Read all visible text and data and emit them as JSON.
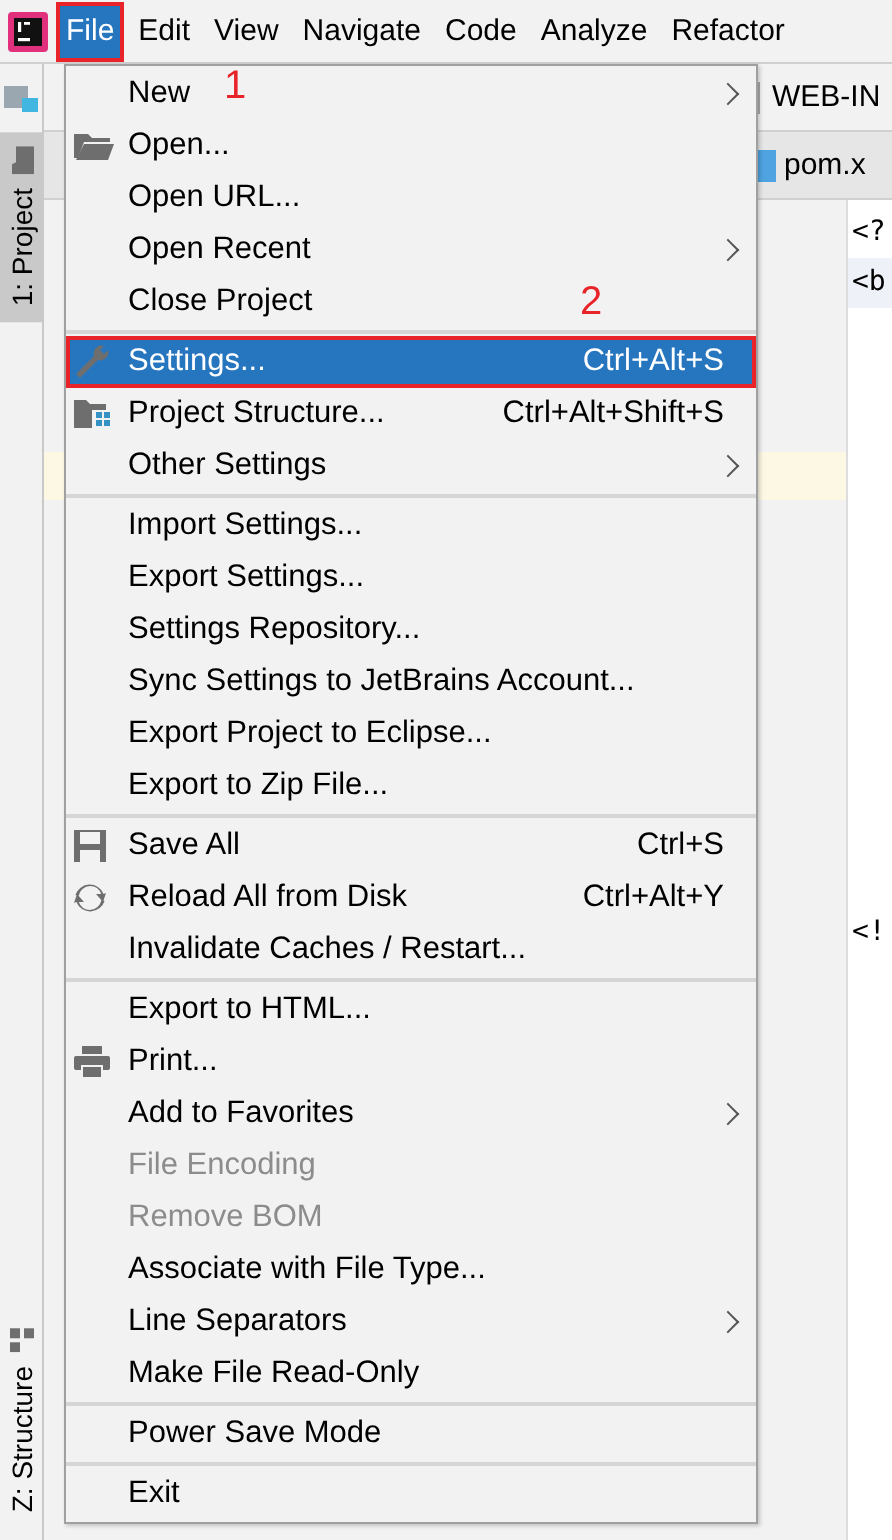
{
  "menubar": [
    {
      "label": "File",
      "selected": true,
      "marked": true
    },
    {
      "label": "Edit",
      "selected": false,
      "marked": false
    },
    {
      "label": "View",
      "selected": false,
      "marked": false
    },
    {
      "label": "Navigate",
      "selected": false,
      "marked": false
    },
    {
      "label": "Code",
      "selected": false,
      "marked": false
    },
    {
      "label": "Analyze",
      "selected": false,
      "marked": false
    },
    {
      "label": "Refactor",
      "selected": false,
      "marked": false
    }
  ],
  "sidebar": {
    "tabs": [
      {
        "label": "1: Project",
        "selected": true
      },
      {
        "label": "Z: Structure",
        "selected": false
      }
    ]
  },
  "editor": {
    "breadcrumb": "WEB-IN",
    "tab": "pom.x",
    "code_lines": [
      "<?",
      "<b",
      "<!"
    ]
  },
  "file_menu": {
    "groups": [
      [
        {
          "label": "New",
          "submenu": true,
          "disabled": false,
          "selected": false,
          "marked": false
        },
        {
          "label": "Open...",
          "submenu": false,
          "disabled": false,
          "selected": false,
          "marked": false
        },
        {
          "label": "Open URL...",
          "submenu": false,
          "disabled": false,
          "selected": false,
          "marked": false
        },
        {
          "label": "Open Recent",
          "submenu": true,
          "disabled": false,
          "selected": false,
          "marked": false
        },
        {
          "label": "Close Project",
          "submenu": false,
          "disabled": false,
          "selected": false,
          "marked": false
        }
      ],
      [
        {
          "label": "Settings...",
          "shortcut": "Ctrl+Alt+S",
          "submenu": false,
          "disabled": false,
          "selected": true,
          "marked": true
        },
        {
          "label": "Project Structure...",
          "shortcut": "Ctrl+Alt+Shift+S",
          "submenu": false,
          "disabled": false,
          "selected": false,
          "marked": false
        },
        {
          "label": "Other Settings",
          "submenu": true,
          "disabled": false,
          "selected": false,
          "marked": false
        }
      ],
      [
        {
          "label": "Import Settings...",
          "submenu": false,
          "disabled": false,
          "selected": false,
          "marked": false
        },
        {
          "label": "Export Settings...",
          "submenu": false,
          "disabled": false,
          "selected": false,
          "marked": false
        },
        {
          "label": "Settings Repository...",
          "submenu": false,
          "disabled": false,
          "selected": false,
          "marked": false
        },
        {
          "label": "Sync Settings to JetBrains Account...",
          "submenu": false,
          "disabled": false,
          "selected": false,
          "marked": false
        },
        {
          "label": "Export Project to Eclipse...",
          "submenu": false,
          "disabled": false,
          "selected": false,
          "marked": false
        },
        {
          "label": "Export to Zip File...",
          "submenu": false,
          "disabled": false,
          "selected": false,
          "marked": false
        }
      ],
      [
        {
          "label": "Save All",
          "shortcut": "Ctrl+S",
          "submenu": false,
          "disabled": false,
          "selected": false,
          "marked": false
        },
        {
          "label": "Reload All from Disk",
          "shortcut": "Ctrl+Alt+Y",
          "submenu": false,
          "disabled": false,
          "selected": false,
          "marked": false
        },
        {
          "label": "Invalidate Caches / Restart...",
          "submenu": false,
          "disabled": false,
          "selected": false,
          "marked": false
        }
      ],
      [
        {
          "label": "Export to HTML...",
          "submenu": false,
          "disabled": false,
          "selected": false,
          "marked": false
        },
        {
          "label": "Print...",
          "submenu": false,
          "disabled": false,
          "selected": false,
          "marked": false
        },
        {
          "label": "Add to Favorites",
          "submenu": true,
          "disabled": false,
          "selected": false,
          "marked": false
        },
        {
          "label": "File Encoding",
          "submenu": false,
          "disabled": true,
          "selected": false,
          "marked": false
        },
        {
          "label": "Remove BOM",
          "submenu": false,
          "disabled": true,
          "selected": false,
          "marked": false
        },
        {
          "label": "Associate with File Type...",
          "submenu": false,
          "disabled": false,
          "selected": false,
          "marked": false
        },
        {
          "label": "Line Separators",
          "submenu": true,
          "disabled": false,
          "selected": false,
          "marked": false
        },
        {
          "label": "Make File Read-Only",
          "submenu": false,
          "disabled": false,
          "selected": false,
          "marked": false
        }
      ],
      [
        {
          "label": "Power Save Mode",
          "submenu": false,
          "disabled": false,
          "selected": false,
          "marked": false
        }
      ],
      [
        {
          "label": "Exit",
          "submenu": false,
          "disabled": false,
          "selected": false,
          "marked": false
        }
      ]
    ]
  },
  "annotations": [
    "1",
    "2"
  ]
}
